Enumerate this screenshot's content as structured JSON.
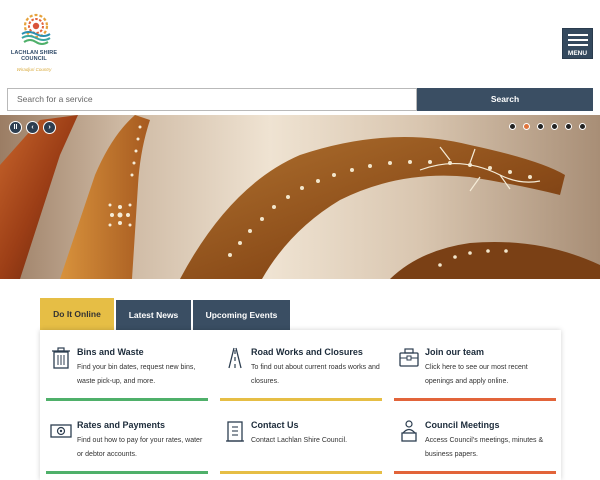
{
  "header": {
    "logo_name_line1": "LACHLAN SHIRE",
    "logo_name_line2": "COUNCIL",
    "logo_tagline": "Wiradjuri Country",
    "menu_label": "MENU"
  },
  "search": {
    "placeholder": "Search for a service",
    "button_label": "Search"
  },
  "hero": {
    "controls": [
      "pause-icon",
      "chevron-left-icon",
      "chevron-right-icon"
    ],
    "slide_count": 6,
    "active_slide": 2
  },
  "tabs": [
    {
      "label": "Do It Online",
      "active": true
    },
    {
      "label": "Latest News",
      "active": false
    },
    {
      "label": "Upcoming Events",
      "active": false
    }
  ],
  "cards": [
    {
      "title": "Bins and Waste",
      "desc": "Find your bin dates, request new bins, waste pick-up, and more.",
      "icon": "bin-icon",
      "color": "#4fb06a"
    },
    {
      "title": "Road Works and Closures",
      "desc": "To find out about current roads works and closures.",
      "icon": "road-icon",
      "color": "#e6be45"
    },
    {
      "title": "Join our team",
      "desc": "Click here to see our most recent openings and apply online.",
      "icon": "briefcase-icon",
      "color": "#e2643a"
    },
    {
      "title": "Rates and Payments",
      "desc": "Find out how to pay for your rates, water or debtor accounts.",
      "icon": "money-icon",
      "color": "#4fb06a"
    },
    {
      "title": "Contact Us",
      "desc": "Contact Lachlan Shire Council.",
      "icon": "contact-icon",
      "color": "#e6be45"
    },
    {
      "title": "Council Meetings",
      "desc": "Access Council’s meetings, minutes & business papers.",
      "icon": "meeting-icon",
      "color": "#e2643a"
    }
  ],
  "colors": {
    "navy": "#3a4e63",
    "gold": "#e6be45",
    "green": "#4fb06a",
    "orange": "#e2643a"
  }
}
